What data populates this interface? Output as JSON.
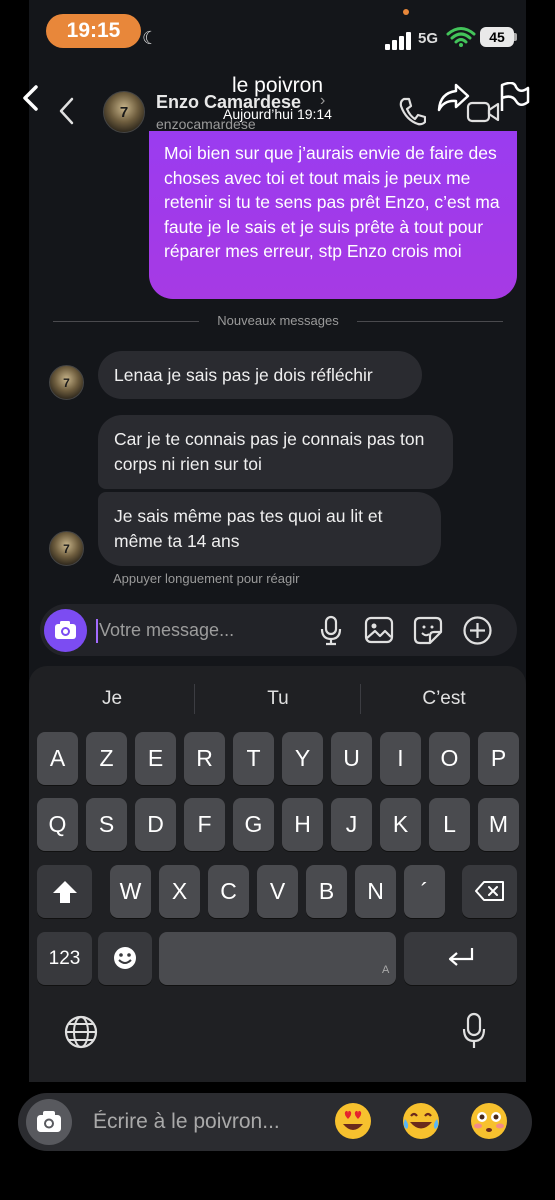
{
  "status_bar": {
    "time": "19:15",
    "network": "5G",
    "battery": "45"
  },
  "story_header": {
    "title": "le poivron",
    "subtitle": "Aujourd’hui 19:14"
  },
  "chat_header": {
    "name": "Enzo Camardese",
    "handle": "enzocamardese",
    "chevron": "›",
    "avatar_number": "7"
  },
  "messages": {
    "outgoing": "Moi bien sur que j’aurais envie de faire des choses avec toi et tout mais je peux me retenir si tu te sens pas prêt Enzo, c’est ma faute je le sais et je suis prête à tout pour réparer mes erreur, stp Enzo crois moi",
    "divider": "Nouveaux messages",
    "incoming": [
      "Lenaa je sais pas je dois réfléchir",
      "Car je te connais pas je connais pas ton corps ni rien sur toi",
      "Je sais même pas tes quoi au lit et même ta 14 ans"
    ],
    "react_hint": "Appuyer longuement pour réagir"
  },
  "composer": {
    "placeholder": "Votre message..."
  },
  "keyboard": {
    "suggestions": [
      "Je",
      "Tu",
      "C’est"
    ],
    "row1": [
      "A",
      "Z",
      "E",
      "R",
      "T",
      "Y",
      "U",
      "I",
      "O",
      "P"
    ],
    "row2": [
      "Q",
      "S",
      "D",
      "F",
      "G",
      "H",
      "J",
      "K",
      "L",
      "M"
    ],
    "row3": [
      "W",
      "X",
      "C",
      "V",
      "B",
      "N",
      "´"
    ],
    "numbers_key": "123",
    "space_hint": "A"
  },
  "reply_bar": {
    "placeholder": "Écrire à le poivron...",
    "emojis": [
      "😍",
      "😂",
      "😳"
    ]
  },
  "colors": {
    "accent_purple": "#7c4cf2",
    "bubble_gradient": "#9a3cf0",
    "time_pill": "#e8873a"
  }
}
